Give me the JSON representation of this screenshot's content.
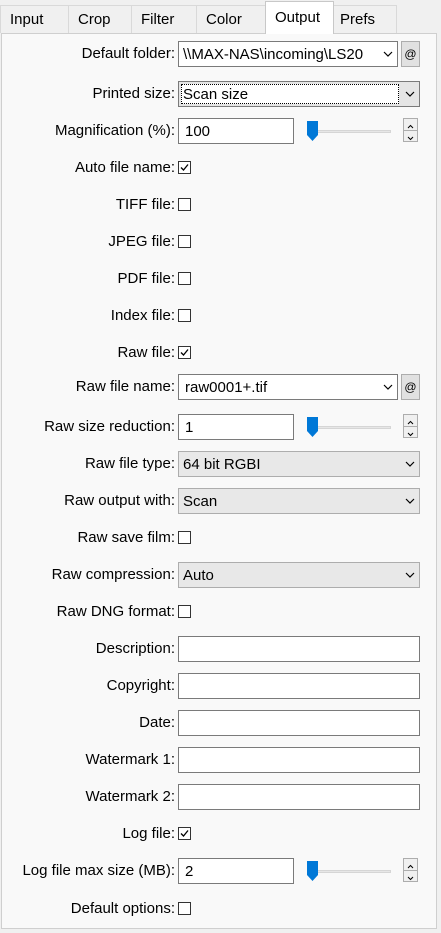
{
  "tabs": [
    "Input",
    "Crop",
    "Filter",
    "Color",
    "Output",
    "Prefs"
  ],
  "active_tab": "Output",
  "at_label": "@",
  "fields": {
    "default_folder": {
      "label": "Default folder:",
      "value": "\\\\MAX-NAS\\incoming\\LS20"
    },
    "printed_size": {
      "label": "Printed size:",
      "value": "Scan size"
    },
    "magnification": {
      "label": "Magnification (%):",
      "value": "100",
      "slider": 0
    },
    "auto_file_name": {
      "label": "Auto file name:",
      "checked": true
    },
    "tiff_file": {
      "label": "TIFF file:",
      "checked": false
    },
    "jpeg_file": {
      "label": "JPEG file:",
      "checked": false
    },
    "pdf_file": {
      "label": "PDF file:",
      "checked": false
    },
    "index_file": {
      "label": "Index file:",
      "checked": false
    },
    "raw_file": {
      "label": "Raw file:",
      "checked": true
    },
    "raw_file_name": {
      "label": "Raw file name:",
      "value": "raw0001+.tif"
    },
    "raw_size_reduction": {
      "label": "Raw size reduction:",
      "value": "1",
      "slider": 0
    },
    "raw_file_type": {
      "label": "Raw file type:",
      "value": "64 bit RGBI"
    },
    "raw_output_with": {
      "label": "Raw output with:",
      "value": "Scan"
    },
    "raw_save_film": {
      "label": "Raw save film:",
      "checked": false
    },
    "raw_compression": {
      "label": "Raw compression:",
      "value": "Auto"
    },
    "raw_dng_format": {
      "label": "Raw DNG format:",
      "checked": false
    },
    "description": {
      "label": "Description:",
      "value": ""
    },
    "copyright": {
      "label": "Copyright:",
      "value": ""
    },
    "date": {
      "label": "Date:",
      "value": ""
    },
    "watermark_1": {
      "label": "Watermark 1:",
      "value": ""
    },
    "watermark_2": {
      "label": "Watermark 2:",
      "value": ""
    },
    "log_file": {
      "label": "Log file:",
      "checked": true
    },
    "log_file_max_size": {
      "label": "Log file max size (MB):",
      "value": "2",
      "slider": 0
    },
    "default_options": {
      "label": "Default options:",
      "checked": false
    }
  },
  "colors": {
    "slider_thumb": "#0078d7",
    "check_mark": "#000000"
  }
}
